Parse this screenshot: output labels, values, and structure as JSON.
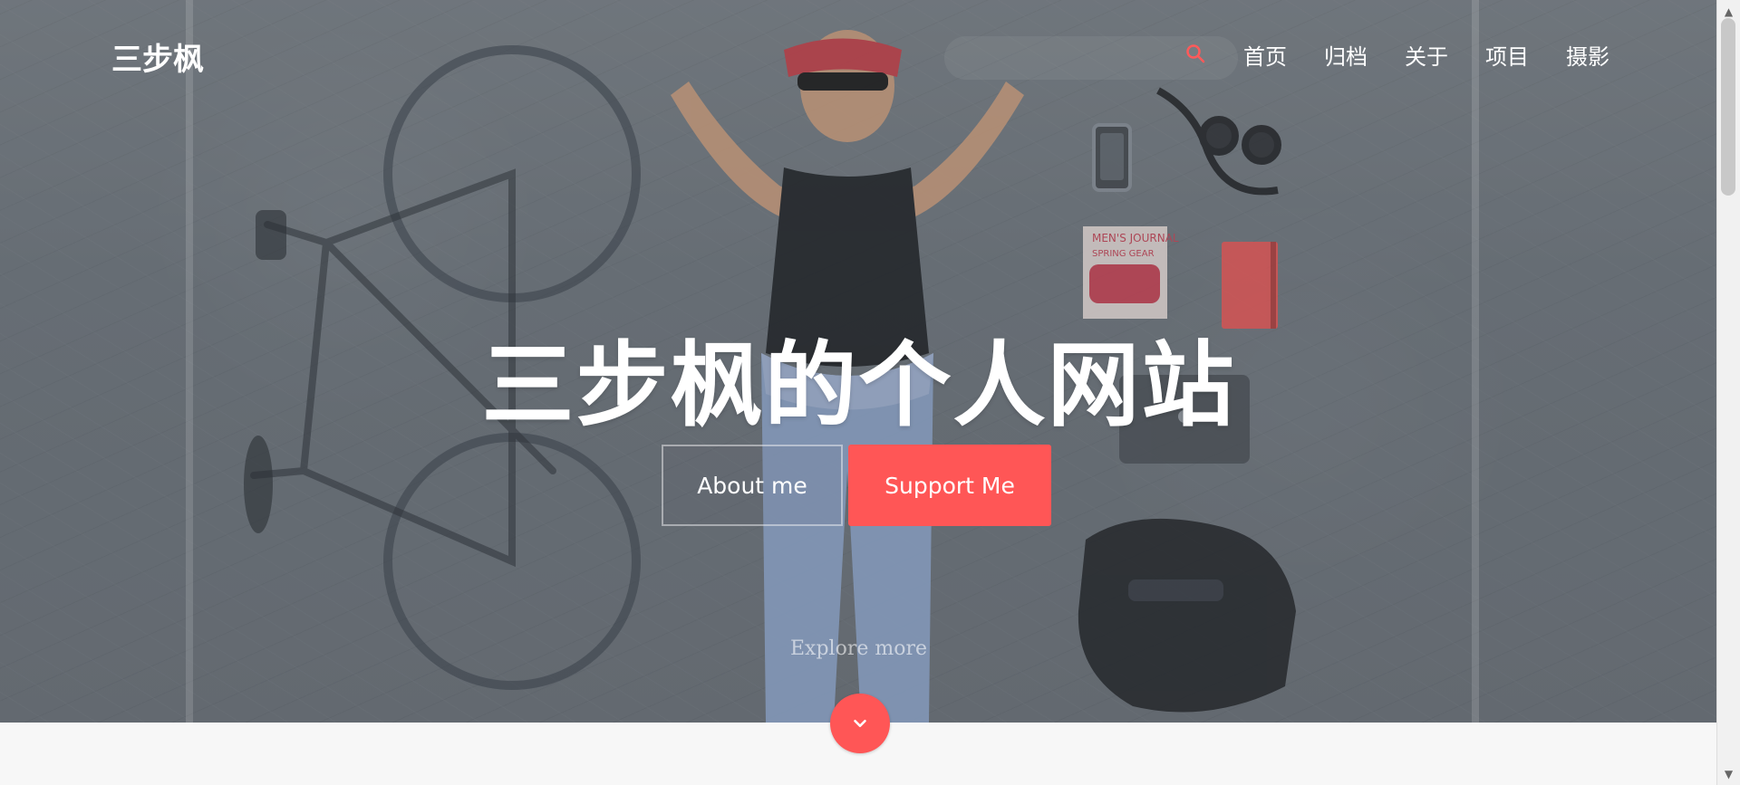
{
  "site": {
    "logo": "三步枫",
    "nav": [
      "首页",
      "归档",
      "关于",
      "项目",
      "摄影"
    ],
    "hero_title": "三步枫的个人网站",
    "buttons": {
      "about": "About me",
      "support": "Support Me"
    },
    "explore": "Explore more"
  },
  "magazine": {
    "title": "MEN'S JOURNAL",
    "subtitle": "SPRING GEAR"
  },
  "colors": {
    "accent": "#ff5656",
    "overlay": "#6f757b"
  },
  "icons": {
    "search": "search-icon",
    "down": "chevron-down-icon"
  }
}
